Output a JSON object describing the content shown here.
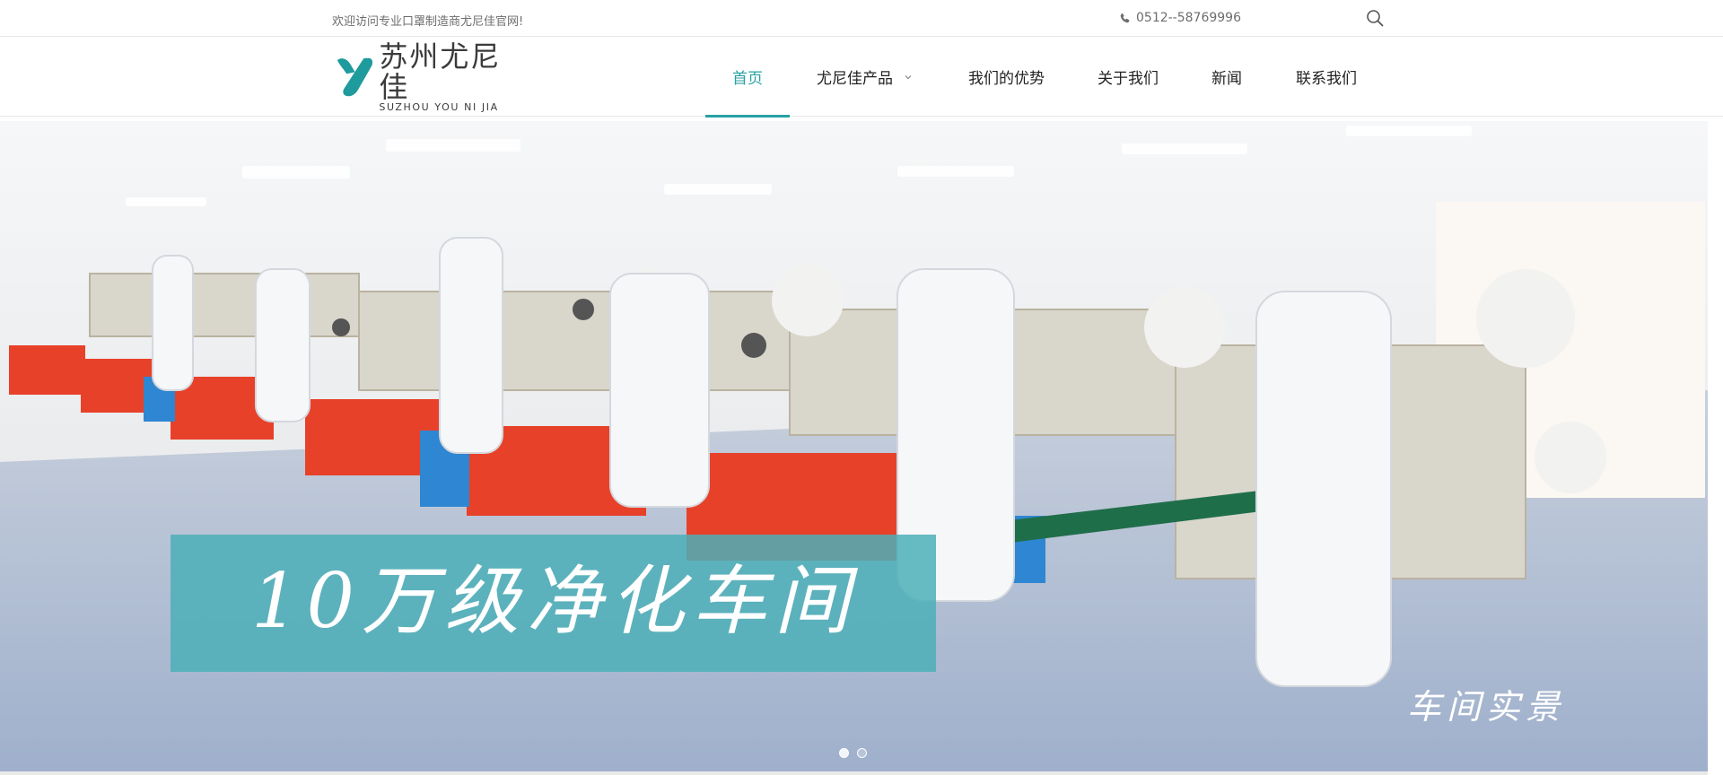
{
  "topbar": {
    "welcome_text": "欢迎访问专业口罩制造商尤尼佳官网!",
    "phone": "0512--58769996",
    "phone_icon": "phone-icon",
    "search_icon": "search-icon"
  },
  "header": {
    "logo": {
      "name_cn": "苏州尤尼佳",
      "name_en": "SUZHOU YOU NI JIA"
    },
    "nav": [
      {
        "label": "首页",
        "active": true
      },
      {
        "label": "尤尼佳产品",
        "active": false,
        "has_dropdown": true
      },
      {
        "label": "我们的优势",
        "active": false
      },
      {
        "label": "关于我们",
        "active": false
      },
      {
        "label": "新闻",
        "active": false
      },
      {
        "label": "联系我们",
        "active": false
      }
    ],
    "accent_color": "#27a1a4"
  },
  "banner": {
    "caption": "10万级净化车间",
    "sub_caption": "车间实景",
    "slide_count": 2,
    "active_slide": 1
  }
}
